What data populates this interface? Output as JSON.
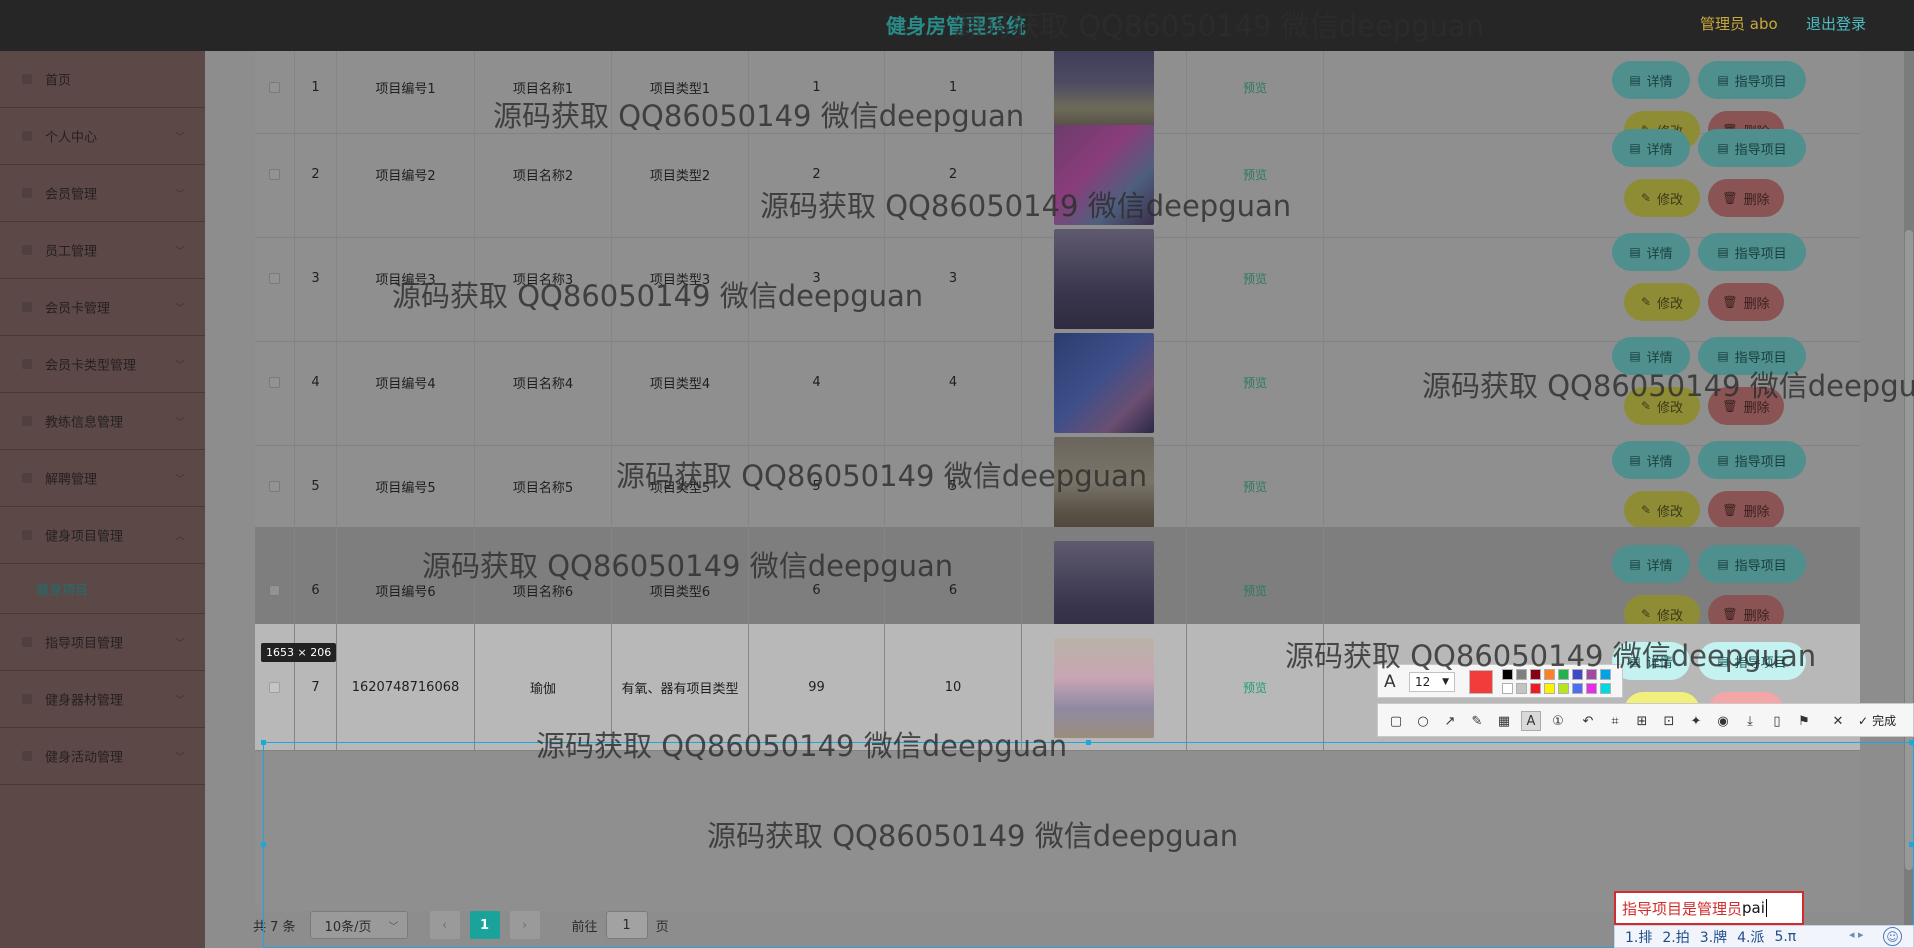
{
  "header": {
    "title": "健身房管理系统",
    "admin_label": "管理员 abo",
    "logout_label": "退出登录"
  },
  "sidebar": {
    "items": [
      {
        "label": "首页",
        "chevron": ""
      },
      {
        "label": "个人中心",
        "chevron": "﹀"
      },
      {
        "label": "会员管理",
        "chevron": "﹀"
      },
      {
        "label": "员工管理",
        "chevron": "﹀"
      },
      {
        "label": "会员卡管理",
        "chevron": "﹀"
      },
      {
        "label": "会员卡类型管理",
        "chevron": "﹀"
      },
      {
        "label": "教练信息管理",
        "chevron": "﹀"
      },
      {
        "label": "解聘管理",
        "chevron": "﹀"
      },
      {
        "label": "健身项目管理",
        "chevron": "︿"
      },
      {
        "label": "指导项目管理",
        "chevron": "﹀"
      },
      {
        "label": "健身器材管理",
        "chevron": "﹀"
      },
      {
        "label": "健身活动管理",
        "chevron": "﹀"
      }
    ],
    "active_sub": "健身项目"
  },
  "table": {
    "rows": [
      {
        "index": "1",
        "code": "项目编号1",
        "name": "项目名称1",
        "type": "项目类型1",
        "col5": "1",
        "col6": "1",
        "preview": "预览",
        "photo": "yoga-class-photo"
      },
      {
        "index": "2",
        "code": "项目编号2",
        "name": "项目名称2",
        "type": "项目类型2",
        "col5": "2",
        "col6": "2",
        "preview": "预览",
        "photo": "aerial-yoga-photo"
      },
      {
        "index": "3",
        "code": "项目编号3",
        "name": "项目名称3",
        "type": "项目类型3",
        "col5": "3",
        "col6": "3",
        "preview": "预览",
        "photo": "gym-studio-photo"
      },
      {
        "index": "4",
        "code": "项目编号4",
        "name": "项目名称4",
        "type": "项目类型4",
        "col5": "4",
        "col6": "4",
        "preview": "预览",
        "photo": "spin-class-photo"
      },
      {
        "index": "5",
        "code": "项目编号5",
        "name": "项目名称5",
        "type": "项目类型5",
        "col5": "5",
        "col6": "5",
        "preview": "预览",
        "photo": "aerial-hammock-photo"
      },
      {
        "index": "6",
        "code": "项目编号6",
        "name": "项目名称6",
        "type": "项目类型6",
        "col5": "6",
        "col6": "6",
        "preview": "预览",
        "photo": "gym-studio-photo"
      },
      {
        "index": "7",
        "code": "1620748716068",
        "name": "瑜伽",
        "type": "有氧、器有项目类型",
        "col5": "99",
        "col6": "10",
        "preview": "预览",
        "photo": "group-yoga-photo"
      }
    ],
    "buttons": {
      "detail": "详情",
      "guide": "指导项目",
      "edit": "修改",
      "delete": "删除"
    }
  },
  "pagination": {
    "total": "共 7 条",
    "page_size": "10条/页",
    "current": "1",
    "goto_prefix": "前往",
    "goto_value": "1",
    "goto_suffix": "页",
    "prev": "‹",
    "next": "›"
  },
  "watermark": "源码获取 QQ86050149 微信deepguan",
  "screenshot_tool": {
    "selection_size": "1653 × 206",
    "font_size": "12",
    "current_color": "#f23b3b",
    "palette": [
      "#000000",
      "#7f7f7f",
      "#880015",
      "#ff7f27",
      "#22b14c",
      "#3f48cc",
      "#a349a4",
      "#00a2e8",
      "#ffffff",
      "#c3c3c3",
      "#ed1c24",
      "#fff200",
      "#b5e61d",
      "#4d6df3",
      "#e62ee6",
      "#00d9e0"
    ],
    "done_label": "完成"
  },
  "annotation": {
    "red_text": "指导项目是管理员",
    "typed_text": "pai"
  },
  "ime": {
    "candidates": [
      "1.排",
      "2.拍",
      "3.牌",
      "4.派",
      "5.π"
    ]
  }
}
